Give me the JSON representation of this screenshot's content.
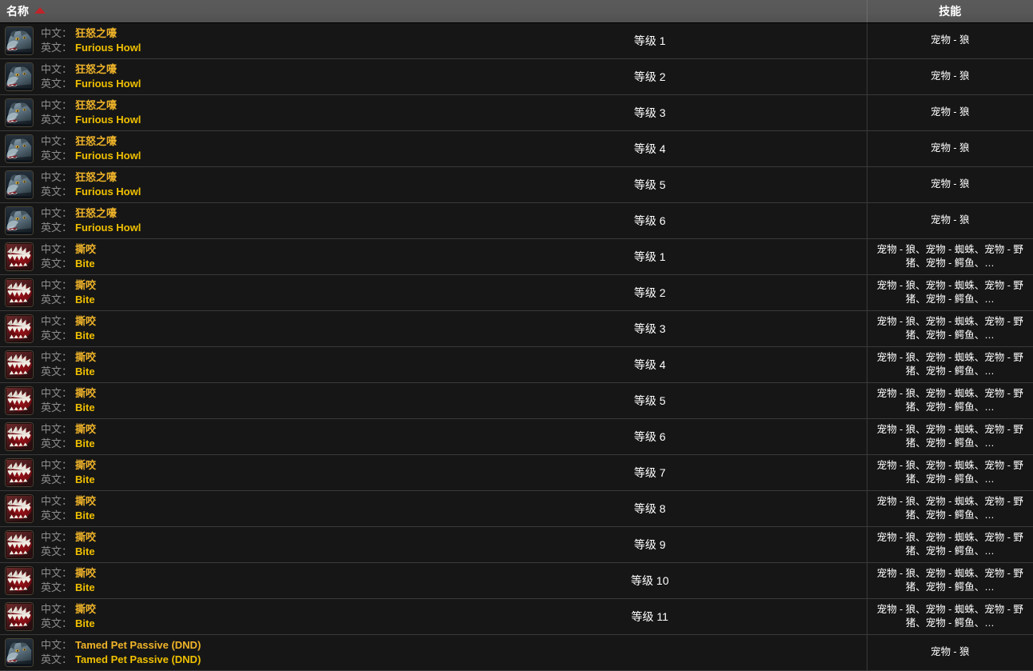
{
  "header": {
    "name_column": "名称",
    "skill_column": "技能",
    "sort_indicator": "ascending-triangle",
    "sort_arrow_color": "#c0242a"
  },
  "labels": {
    "chinese": "中文：",
    "english": "英文："
  },
  "colors": {
    "header_bg": "#585858",
    "row_bg": "#161616",
    "row_border": "#3a3a3a",
    "label_text": "#8c8c8c",
    "value_text": "#f0b429",
    "level_text": "#ffffff"
  },
  "skill_values": {
    "wolf_only": "宠物 - 狼",
    "many_pets": "宠物 - 狼、宠物 - 蜘蛛、宠物 - 野猪、宠物 - 鳄鱼、…"
  },
  "rows": [
    {
      "icon": "wolf-icon",
      "cn": "狂怒之嚎",
      "en": "Furious Howl",
      "level": "等级 1",
      "skill": "宠物 - 狼"
    },
    {
      "icon": "wolf-icon",
      "cn": "狂怒之嚎",
      "en": "Furious Howl",
      "level": "等级 2",
      "skill": "宠物 - 狼"
    },
    {
      "icon": "wolf-icon",
      "cn": "狂怒之嚎",
      "en": "Furious Howl",
      "level": "等级 3",
      "skill": "宠物 - 狼"
    },
    {
      "icon": "wolf-icon",
      "cn": "狂怒之嚎",
      "en": "Furious Howl",
      "level": "等级 4",
      "skill": "宠物 - 狼"
    },
    {
      "icon": "wolf-icon",
      "cn": "狂怒之嚎",
      "en": "Furious Howl",
      "level": "等级 5",
      "skill": "宠物 - 狼"
    },
    {
      "icon": "wolf-icon",
      "cn": "狂怒之嚎",
      "en": "Furious Howl",
      "level": "等级 6",
      "skill": "宠物 - 狼"
    },
    {
      "icon": "bite-icon",
      "cn": "撕咬",
      "en": "Bite",
      "level": "等级 1",
      "skill": "宠物 - 狼、宠物 - 蜘蛛、宠物 - 野猪、宠物 - 鳄鱼、…"
    },
    {
      "icon": "bite-icon",
      "cn": "撕咬",
      "en": "Bite",
      "level": "等级 2",
      "skill": "宠物 - 狼、宠物 - 蜘蛛、宠物 - 野猪、宠物 - 鳄鱼、…"
    },
    {
      "icon": "bite-icon",
      "cn": "撕咬",
      "en": "Bite",
      "level": "等级 3",
      "skill": "宠物 - 狼、宠物 - 蜘蛛、宠物 - 野猪、宠物 - 鳄鱼、…"
    },
    {
      "icon": "bite-icon",
      "cn": "撕咬",
      "en": "Bite",
      "level": "等级 4",
      "skill": "宠物 - 狼、宠物 - 蜘蛛、宠物 - 野猪、宠物 - 鳄鱼、…"
    },
    {
      "icon": "bite-icon",
      "cn": "撕咬",
      "en": "Bite",
      "level": "等级 5",
      "skill": "宠物 - 狼、宠物 - 蜘蛛、宠物 - 野猪、宠物 - 鳄鱼、…"
    },
    {
      "icon": "bite-icon",
      "cn": "撕咬",
      "en": "Bite",
      "level": "等级 6",
      "skill": "宠物 - 狼、宠物 - 蜘蛛、宠物 - 野猪、宠物 - 鳄鱼、…"
    },
    {
      "icon": "bite-icon",
      "cn": "撕咬",
      "en": "Bite",
      "level": "等级 7",
      "skill": "宠物 - 狼、宠物 - 蜘蛛、宠物 - 野猪、宠物 - 鳄鱼、…"
    },
    {
      "icon": "bite-icon",
      "cn": "撕咬",
      "en": "Bite",
      "level": "等级 8",
      "skill": "宠物 - 狼、宠物 - 蜘蛛、宠物 - 野猪、宠物 - 鳄鱼、…"
    },
    {
      "icon": "bite-icon",
      "cn": "撕咬",
      "en": "Bite",
      "level": "等级 9",
      "skill": "宠物 - 狼、宠物 - 蜘蛛、宠物 - 野猪、宠物 - 鳄鱼、…"
    },
    {
      "icon": "bite-icon",
      "cn": "撕咬",
      "en": "Bite",
      "level": "等级 10",
      "skill": "宠物 - 狼、宠物 - 蜘蛛、宠物 - 野猪、宠物 - 鳄鱼、…"
    },
    {
      "icon": "bite-icon",
      "cn": "撕咬",
      "en": "Bite",
      "level": "等级 11",
      "skill": "宠物 - 狼、宠物 - 蜘蛛、宠物 - 野猪、宠物 - 鳄鱼、…"
    },
    {
      "icon": "wolf-icon",
      "cn": "Tamed Pet Passive (DND)",
      "en": "Tamed Pet Passive (DND)",
      "level": "",
      "skill": "宠物 - 狼"
    }
  ]
}
